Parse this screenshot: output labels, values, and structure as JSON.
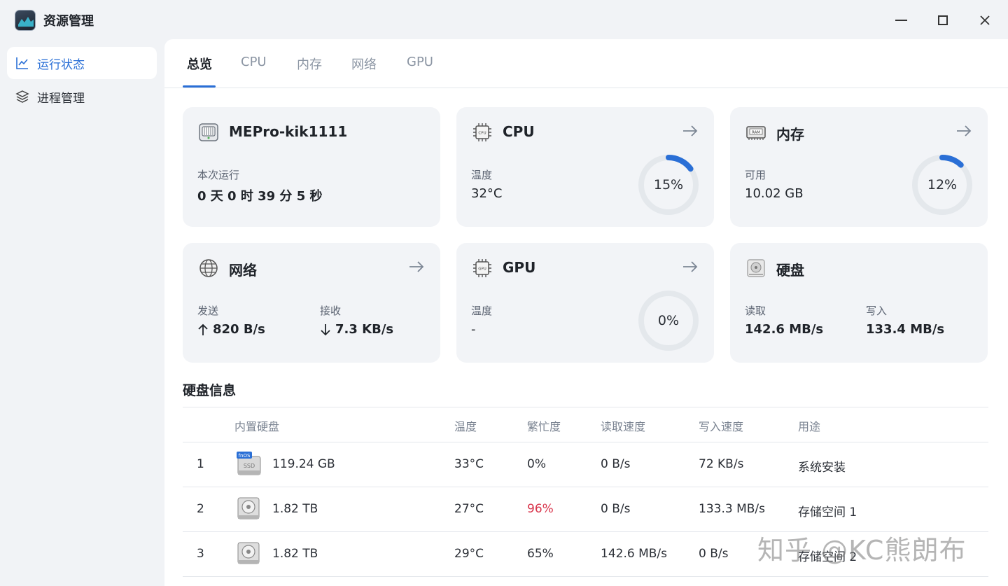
{
  "app": {
    "title": "资源管理"
  },
  "sidebar": {
    "items": [
      {
        "label": "运行状态",
        "icon": "chart-line-icon",
        "active": true
      },
      {
        "label": "进程管理",
        "icon": "layers-icon",
        "active": false
      }
    ]
  },
  "tabs": [
    {
      "label": "总览",
      "active": true
    },
    {
      "label": "CPU"
    },
    {
      "label": "内存"
    },
    {
      "label": "网络"
    },
    {
      "label": "GPU"
    }
  ],
  "cards": {
    "system": {
      "title": "MEPro-kik1111",
      "label": "本次运行",
      "value": "0 天 0 时 39 分 5 秒"
    },
    "cpu": {
      "title": "CPU",
      "label": "温度",
      "value": "32°C",
      "usage_text": "15%",
      "usage": 0.15
    },
    "memory": {
      "title": "内存",
      "label": "可用",
      "value": "10.02 GB",
      "usage_text": "12%",
      "usage": 0.12
    },
    "network": {
      "title": "网络",
      "send_label": "发送",
      "send_value": "820 B/s",
      "recv_label": "接收",
      "recv_value": "7.3 KB/s"
    },
    "gpu": {
      "title": "GPU",
      "label": "温度",
      "value": "-",
      "usage_text": "0%",
      "usage": 0
    },
    "disk": {
      "title": "硬盘",
      "read_label": "读取",
      "read_value": "142.6 MB/s",
      "write_label": "写入",
      "write_value": "133.4 MB/s"
    }
  },
  "disk_info": {
    "title": "硬盘信息",
    "headers": [
      "内置硬盘",
      "温度",
      "繁忙度",
      "读取速度",
      "写入速度",
      "用途"
    ],
    "rows": [
      {
        "index": "1",
        "size": "119.24 GB",
        "temp": "33°C",
        "busy": "0%",
        "read": "0 B/s",
        "write": "72 KB/s",
        "usage": "系统安装",
        "icon_badge": "fnOS",
        "icon_label": "SSD"
      },
      {
        "index": "2",
        "size": "1.82 TB",
        "temp": "27°C",
        "busy": "96%",
        "read": "0 B/s",
        "write": "133.3 MB/s",
        "usage": "存储空间 1"
      },
      {
        "index": "3",
        "size": "1.82 TB",
        "temp": "29°C",
        "busy": "65%",
        "read": "142.6 MB/s",
        "write": "0 B/s",
        "usage": "存储空间 2"
      }
    ]
  },
  "watermark": "知乎 @KC熊朗布",
  "colors": {
    "accent": "#2a6fd6",
    "hot": "#d8334a",
    "card_bg": "#f2f4f7"
  }
}
